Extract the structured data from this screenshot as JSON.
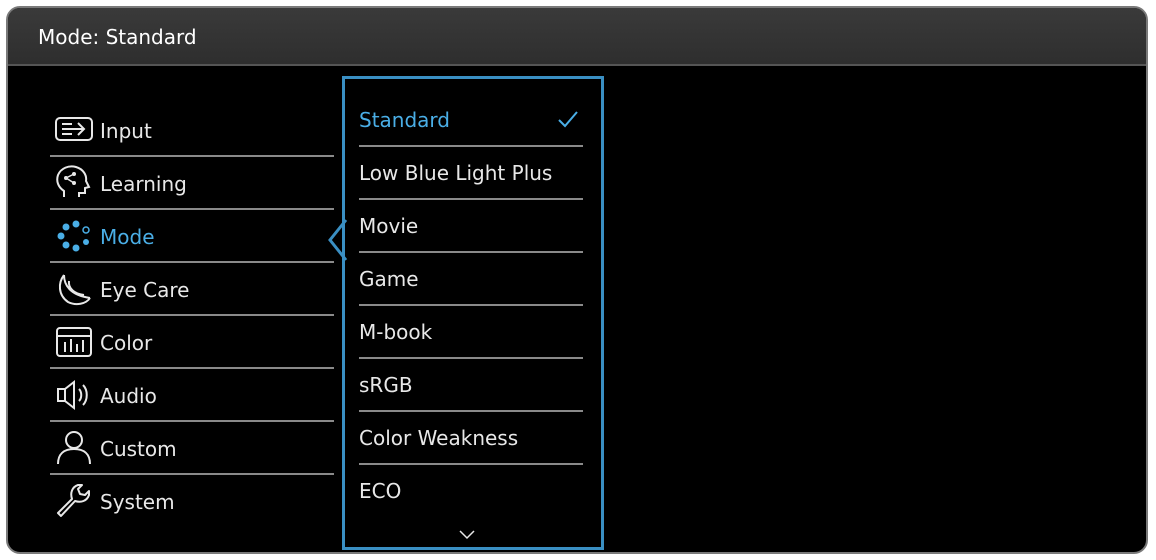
{
  "title": "Mode: Standard",
  "menu": {
    "items": [
      {
        "label": "Input",
        "icon": "input-icon"
      },
      {
        "label": "Learning",
        "icon": "learning-icon"
      },
      {
        "label": "Mode",
        "icon": "mode-icon"
      },
      {
        "label": "Eye Care",
        "icon": "eye-care-icon"
      },
      {
        "label": "Color",
        "icon": "color-icon"
      },
      {
        "label": "Audio",
        "icon": "audio-icon"
      },
      {
        "label": "Custom",
        "icon": "custom-icon"
      },
      {
        "label": "System",
        "icon": "system-icon"
      }
    ],
    "active": "Mode"
  },
  "submenu": {
    "items": [
      {
        "label": "Standard"
      },
      {
        "label": "Low Blue Light Plus"
      },
      {
        "label": "Movie"
      },
      {
        "label": "Game"
      },
      {
        "label": "M-book"
      },
      {
        "label": "sRGB"
      },
      {
        "label": "Color Weakness"
      },
      {
        "label": "ECO"
      }
    ],
    "selected": "Standard"
  },
  "colors": {
    "accent": "#4aaee6",
    "frame": "#3a8fc3",
    "background": "#000000",
    "text": "#e8e8e8"
  }
}
